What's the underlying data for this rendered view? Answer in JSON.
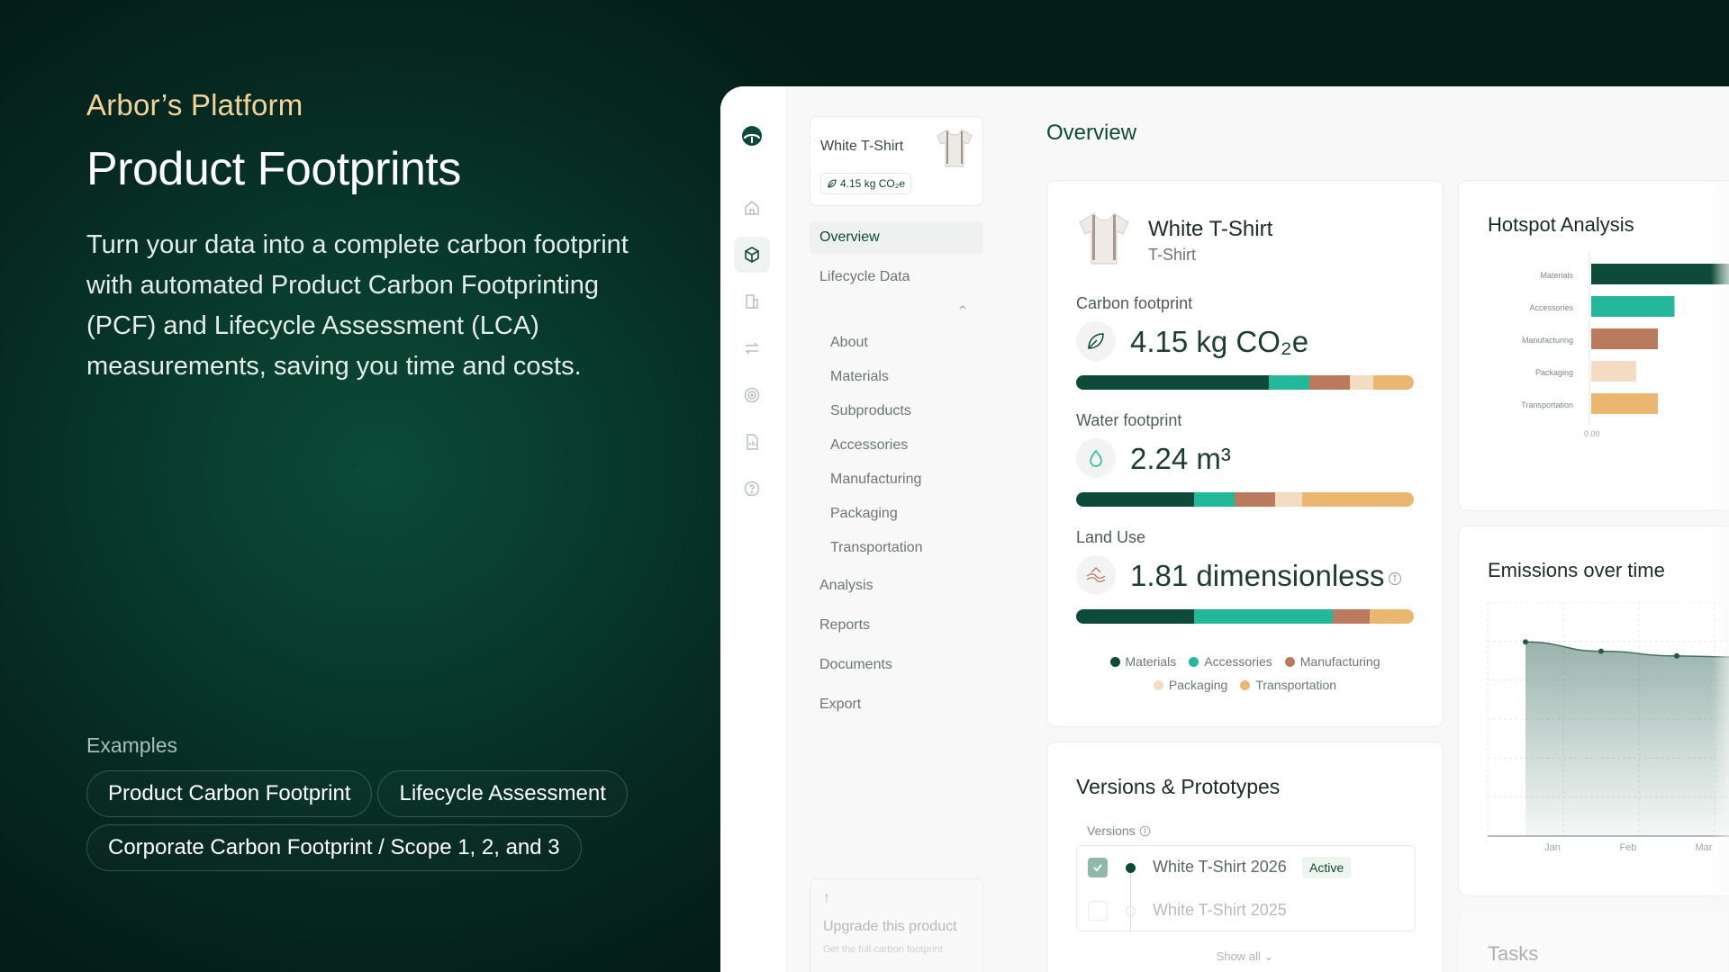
{
  "hero": {
    "eyebrow": "Arbor’s Platform",
    "title": "Product Footprints",
    "description": "Turn your data into a complete carbon footprint with automated Product Carbon Footprinting (PCF) and Lifecycle Assessment (LCA) measurements, saving you time and costs.",
    "examples_label": "Examples",
    "examples": [
      "Product Carbon Footprint",
      "Lifecycle Assessment",
      "Corporate Carbon Footprint / Scope 1, 2, and 3"
    ]
  },
  "rail": {
    "icons": [
      "arbor-logo-icon",
      "home-icon",
      "box-icon",
      "building-icon",
      "transfer-icon",
      "target-icon",
      "report-icon",
      "help-icon"
    ],
    "active": "box-icon"
  },
  "product_card": {
    "name": "White T-Shirt",
    "tag": "4.15 kg CO₂e"
  },
  "subnav": {
    "overview": "Overview",
    "lifecycle": "Lifecycle Data",
    "lifecycle_items": [
      "About",
      "Materials",
      "Subproducts",
      "Accessories",
      "Manufacturing",
      "Packaging",
      "Transportation"
    ],
    "analysis": "Analysis",
    "reports": "Reports",
    "documents": "Documents",
    "export": "Export"
  },
  "upgrade": {
    "arrow": "↑",
    "title": "Upgrade this product",
    "subtitle": "Get the full carbon footprint"
  },
  "main": {
    "title": "Overview"
  },
  "overview_card": {
    "name": "White T-Shirt",
    "category": "T-Shirt",
    "carbon": {
      "label": "Carbon footprint",
      "value": "4.15 kg CO₂e",
      "shares": [
        0.57,
        0.12,
        0.12,
        0.07,
        0.12
      ]
    },
    "water": {
      "label": "Water footprint",
      "value": "2.24 m³",
      "shares": [
        0.35,
        0.12,
        0.12,
        0.08,
        0.33
      ]
    },
    "land": {
      "label": "Land Use",
      "value": "1.81 dimensionless",
      "shares": [
        0.35,
        0.41,
        0.11,
        0.0,
        0.13
      ]
    },
    "legend": [
      {
        "name": "Materials",
        "color": "#0d4a39"
      },
      {
        "name": "Accessories",
        "color": "#23b89a"
      },
      {
        "name": "Manufacturing",
        "color": "#b97a5e"
      },
      {
        "name": "Packaging",
        "color": "#f4dcc3"
      },
      {
        "name": "Transportation",
        "color": "#e9b76f"
      }
    ]
  },
  "versions": {
    "title": "Versions & Prototypes",
    "label": "Versions",
    "items": [
      {
        "name": "White T-Shirt 2026",
        "badge": "Active",
        "checked": true
      },
      {
        "name": "White T-Shirt 2025",
        "badge": "",
        "checked": false
      }
    ],
    "show_all": "Show all"
  },
  "hotspot": {
    "title": "Hotspot Analysis"
  },
  "emissions": {
    "title": "Emissions over time"
  },
  "tasks": {
    "title": "Tasks"
  },
  "chart_data": [
    {
      "type": "bar",
      "orientation": "horizontal",
      "title": "Hotspot Analysis",
      "categories": [
        "Materials",
        "Accessories",
        "Manufacturing",
        "Packaging",
        "Transportation"
      ],
      "values": [
        1.0,
        0.5,
        0.4,
        0.27,
        0.4
      ],
      "colors": [
        "#0d4a39",
        "#23b89a",
        "#b97a5e",
        "#f4dcc3",
        "#e9b76f"
      ],
      "x_tick": "0.00",
      "xlim": [
        0,
        1.0
      ]
    },
    {
      "type": "area",
      "title": "Emissions over time",
      "categories": [
        "Jan",
        "Feb",
        "Mar"
      ],
      "values": [
        0.83,
        0.79,
        0.77
      ],
      "ylim": [
        0,
        1
      ],
      "grid": true
    }
  ]
}
